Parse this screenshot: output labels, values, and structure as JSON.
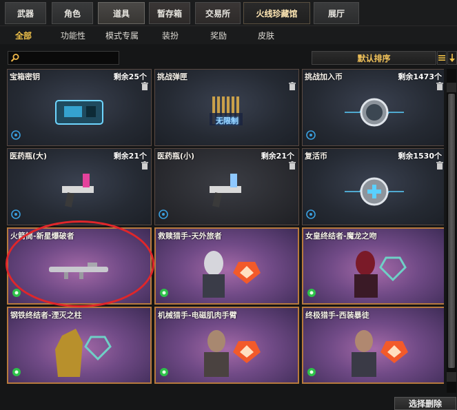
{
  "tabs": [
    {
      "label": "武器"
    },
    {
      "label": "角色"
    },
    {
      "label": "道具"
    },
    {
      "label": "暂存箱"
    },
    {
      "label": "交易所"
    },
    {
      "label": "火线珍藏馆"
    },
    {
      "label": "展厅"
    }
  ],
  "subtabs": [
    {
      "label": "全部"
    },
    {
      "label": "功能性"
    },
    {
      "label": "模式专属"
    },
    {
      "label": "装扮"
    },
    {
      "label": "奖励"
    },
    {
      "label": "皮肤"
    }
  ],
  "search": {
    "value": "",
    "placeholder": ""
  },
  "sort": {
    "label": "默认排序"
  },
  "items": [
    {
      "name": "宝箱密钥",
      "count": "剩余25个"
    },
    {
      "name": "挑战弹匣",
      "count": "",
      "tag": "无限制"
    },
    {
      "name": "挑战加入币",
      "count": "剩余1473个"
    },
    {
      "name": "医药瓶(大)",
      "count": "剩余21个"
    },
    {
      "name": "医药瓶(小)",
      "count": "剩余21个"
    },
    {
      "name": "复活币",
      "count": "剩余1530个"
    },
    {
      "name": "火箭筒-新星爆破者",
      "count": ""
    },
    {
      "name": "救赎猎手-天外旅者",
      "count": ""
    },
    {
      "name": "女皇终结者-魔龙之吻",
      "count": ""
    },
    {
      "name": "钢铁终结者-湮灭之柱",
      "count": ""
    },
    {
      "name": "机械猎手-电磁肌肉手臂",
      "count": ""
    },
    {
      "name": "终极猎手-西装暴徒",
      "count": ""
    }
  ],
  "footer": {
    "select_delete": "选择删除"
  }
}
